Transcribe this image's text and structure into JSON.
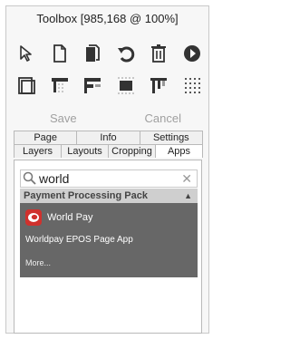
{
  "window": {
    "title": "Toolbox [985,168 @ 100%]"
  },
  "toolbar": {
    "row1": [
      "pointer-icon",
      "new-page-icon",
      "duplicate-page-icon",
      "undo-icon",
      "trash-icon",
      "play-icon"
    ],
    "row2": [
      "page-frame-icon",
      "align-top-icon",
      "align-left-icon",
      "center-icon",
      "grid-align-icon",
      "dot-grid-icon"
    ]
  },
  "actions": {
    "save_label": "Save",
    "cancel_label": "Cancel"
  },
  "tabs": {
    "top": [
      "Page",
      "Info",
      "Settings"
    ],
    "bottom": [
      "Layers",
      "Layouts",
      "Cropping",
      "Apps"
    ],
    "active": "Apps"
  },
  "search": {
    "value": "world"
  },
  "pack": {
    "title": "Payment Processing Pack",
    "item_name": "World Pay",
    "item_desc": "Worldpay EPOS Page App",
    "more_label": "More..."
  },
  "colors": {
    "accent": "#d0312d",
    "pack_bg": "#676767",
    "pack_header": "#cfcfcf"
  }
}
